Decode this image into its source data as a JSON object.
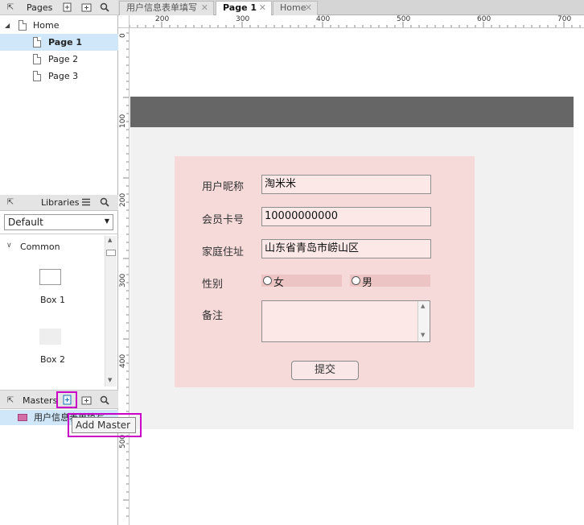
{
  "pages_panel": {
    "title": "Pages",
    "items": [
      "Home",
      "Page 1",
      "Page 2",
      "Page 3"
    ]
  },
  "libraries_panel": {
    "title": "Libraries",
    "dropdown": "Default",
    "section": "Common",
    "widgets": [
      "Box 1",
      "Box 2"
    ]
  },
  "masters_panel": {
    "title": "Masters",
    "item": "用户信息表单填写",
    "tooltip": "Add Master"
  },
  "tabs": [
    "用户信息表单填写",
    "Page 1",
    "Home"
  ],
  "ruler": {
    "h_ticks": [
      "200",
      "300",
      "400",
      "500",
      "600",
      "700"
    ],
    "v_ticks": [
      "0",
      "100",
      "200",
      "300",
      "400",
      "500"
    ]
  },
  "form": {
    "nickname_label": "用户昵称",
    "nickname_value": "淘米米",
    "card_label": "会员卡号",
    "card_value": "10000000000",
    "address_label": "家庭住址",
    "address_value": "山东省青岛市崂山区",
    "gender_label": "性别",
    "female": "女",
    "male": "男",
    "notes_label": "备注",
    "submit": "提交"
  },
  "colors": {
    "highlight": "#c800c8",
    "form_bg": "#f6d9d9",
    "header_bar": "#666666",
    "selection": "#cfe7f8"
  }
}
